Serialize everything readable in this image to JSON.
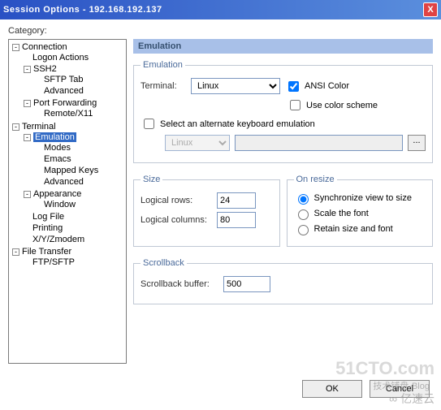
{
  "titlebar": {
    "text": "Session Options - 192.168.192.137",
    "close": "X"
  },
  "category_label": "Category:",
  "tree": {
    "connection": "Connection",
    "logon_actions": "Logon Actions",
    "ssh2": "SSH2",
    "sftp_tab": "SFTP Tab",
    "advanced1": "Advanced",
    "port_forwarding": "Port Forwarding",
    "remote_x11": "Remote/X11",
    "terminal": "Terminal",
    "emulation": "Emulation",
    "modes": "Modes",
    "emacs": "Emacs",
    "mapped_keys": "Mapped Keys",
    "advanced2": "Advanced",
    "appearance": "Appearance",
    "window": "Window",
    "log_file": "Log File",
    "printing": "Printing",
    "xyzmodem": "X/Y/Zmodem",
    "file_transfer": "File Transfer",
    "ftp_sftp": "FTP/SFTP"
  },
  "panel": {
    "header": "Emulation",
    "emulation_group": "Emulation",
    "terminal_label": "Terminal:",
    "terminal_value": "Linux",
    "ansi_color": "ANSI Color",
    "ansi_color_checked": true,
    "use_color_scheme": "Use color scheme",
    "use_color_scheme_checked": false,
    "alternate_kbd": "Select an alternate keyboard emulation",
    "alternate_kbd_checked": false,
    "alt_value": "Linux",
    "size_group": "Size",
    "logical_rows_label": "Logical rows:",
    "logical_rows": "24",
    "logical_cols_label": "Logical columns:",
    "logical_cols": "80",
    "onresize_group": "On resize",
    "sync": "Synchronize view to size",
    "scale": "Scale the font",
    "retain": "Retain size and font",
    "scrollback_group": "Scrollback",
    "scrollback_label": "Scrollback buffer:",
    "scrollback": "500",
    "browse": "..."
  },
  "buttons": {
    "ok": "OK",
    "cancel": "Cancel"
  },
  "watermark": {
    "brand": "51CTO.com",
    "sub": "技术铺盘-Blog",
    "cloud": "∞ 亿速云"
  }
}
